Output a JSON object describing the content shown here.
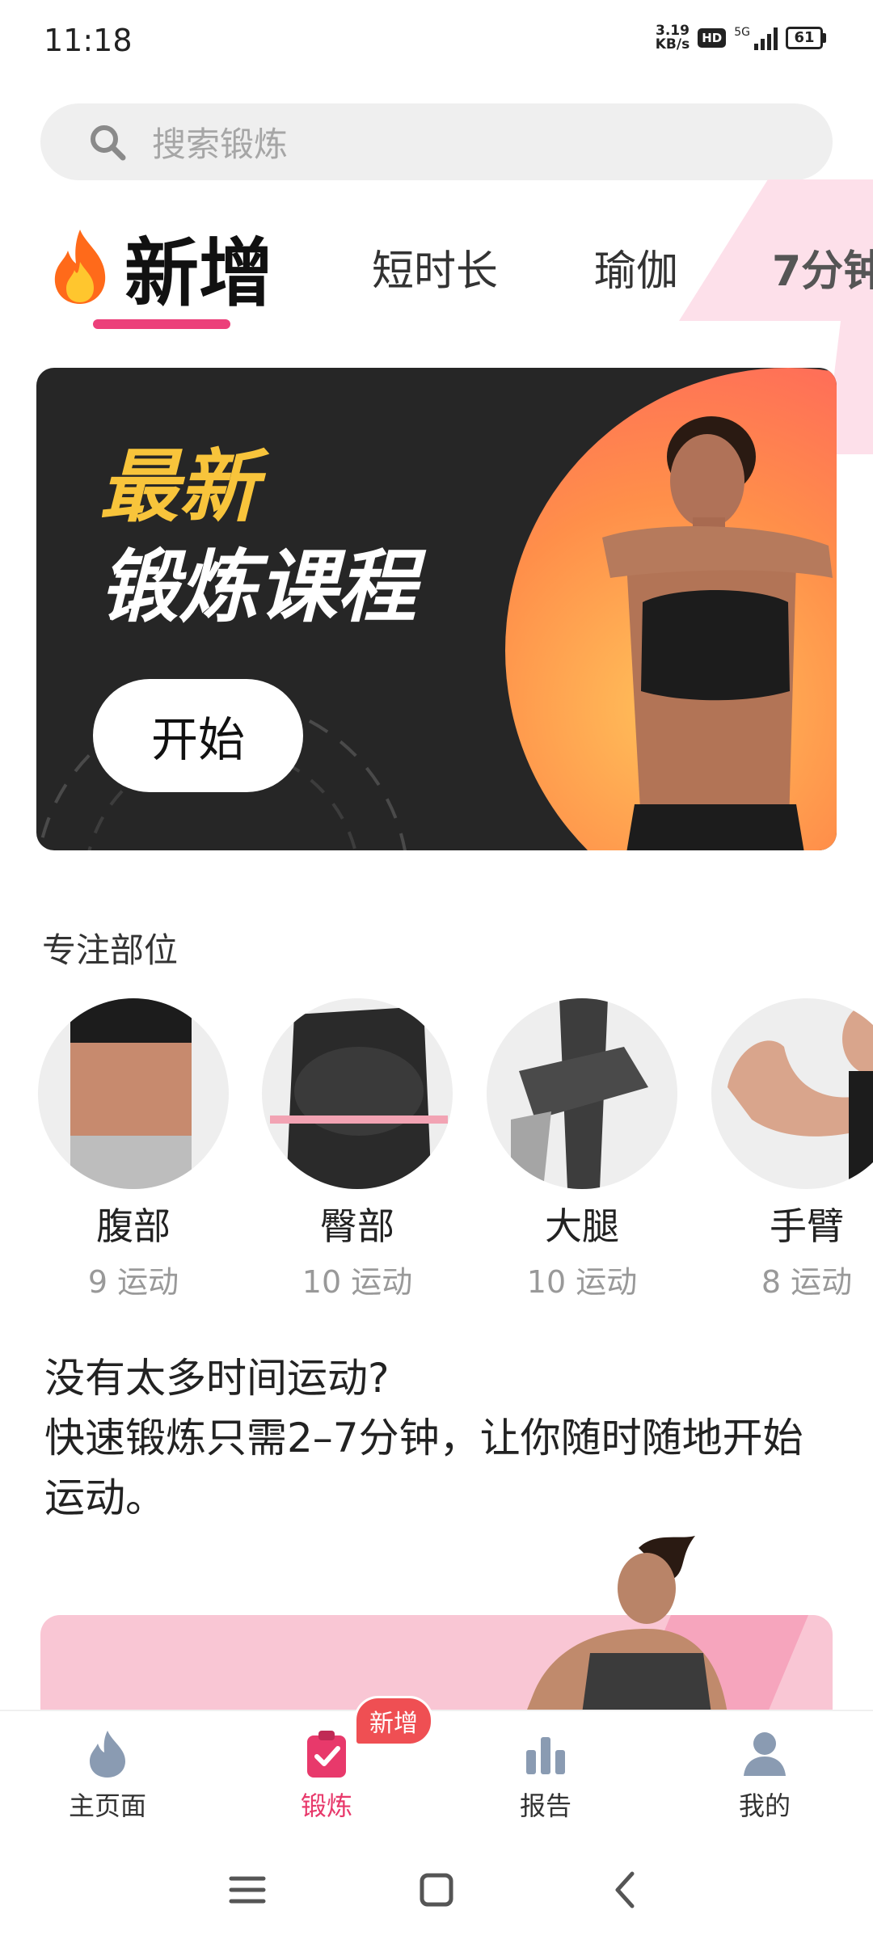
{
  "status_bar": {
    "time": "11:18",
    "net_speed_value": "3.19",
    "net_speed_unit": "KB/s",
    "hd_label": "HD",
    "network_label": "5G",
    "battery": "61"
  },
  "search": {
    "placeholder": "搜索锻炼"
  },
  "tabs": [
    {
      "label": "新增",
      "active": true
    },
    {
      "label": "短时长"
    },
    {
      "label": "瑜伽"
    },
    {
      "label": "7分钟"
    }
  ],
  "banner": {
    "title_line1": "最新",
    "title_line2": "锻炼课程",
    "start_label": "开始"
  },
  "focus": {
    "title": "专注部位",
    "items": [
      {
        "name": "腹部",
        "count": "9 运动"
      },
      {
        "name": "臀部",
        "count": "10 运动"
      },
      {
        "name": "大腿",
        "count": "10 运动"
      },
      {
        "name": "手臂",
        "count": "8 运动"
      }
    ]
  },
  "quick": {
    "line1": "没有太多时间运动?",
    "line2": "快速锻炼只需2–7分钟，让你随时随地开始运动。"
  },
  "bottom_nav": {
    "items": [
      {
        "label": "主页面",
        "icon": "flame-icon"
      },
      {
        "label": "锻炼",
        "icon": "clipboard-check-icon",
        "active": true
      },
      {
        "label": "报告",
        "icon": "bar-chart-icon"
      },
      {
        "label": "我的",
        "icon": "person-icon"
      }
    ],
    "badge": "新增"
  },
  "colors": {
    "accent": "#e8396b",
    "banner_bg": "#262626",
    "banner_highlight": "#f8c43b",
    "pink_card": "#f9c6d4"
  }
}
